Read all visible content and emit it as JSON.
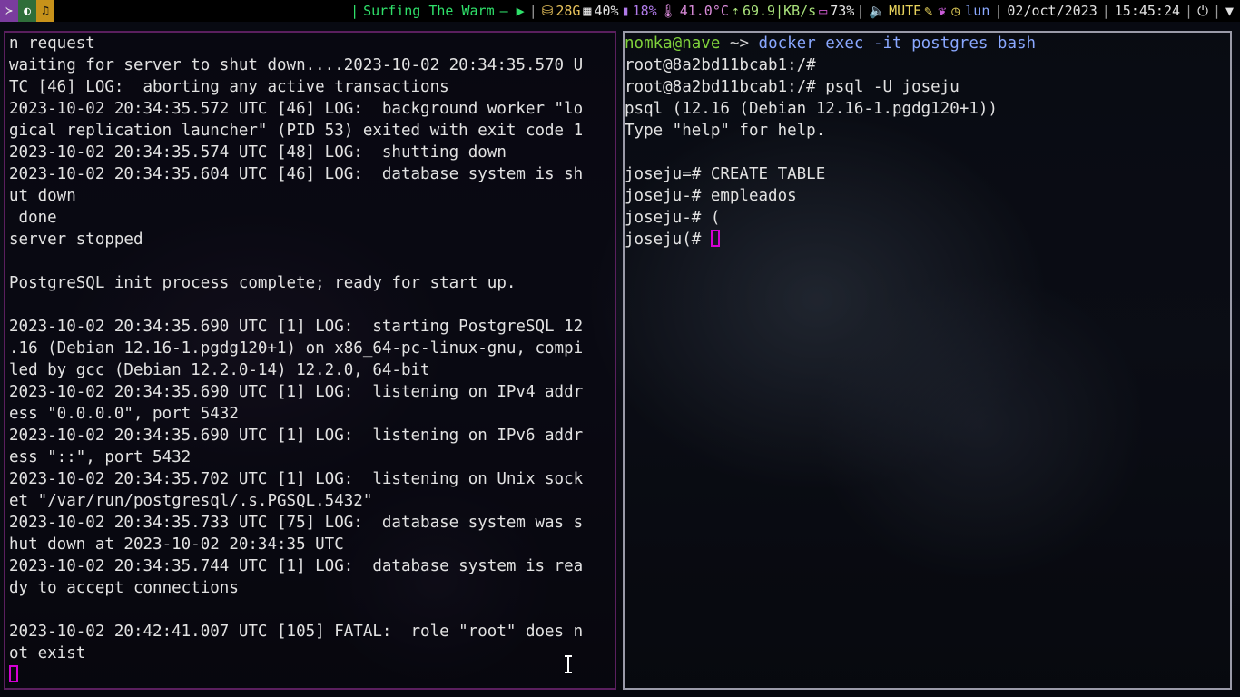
{
  "workspaces": [
    "≻",
    "◐",
    "♫"
  ],
  "bar": {
    "now_playing": "Surfing The Warm",
    "playback": "— ▶",
    "disk": "28G",
    "cpu": "40%",
    "mem": "18%",
    "temp": "41.0°C",
    "net": "69.9|KB/s",
    "battery": "73%",
    "volume": "MUTE",
    "day": "lun",
    "date": "02/oct/2023",
    "time": "15:45:24"
  },
  "left_terminal": {
    "lines": [
      "n request",
      "waiting for server to shut down....2023-10-02 20:34:35.570 U",
      "TC [46] LOG:  aborting any active transactions",
      "2023-10-02 20:34:35.572 UTC [46] LOG:  background worker \"lo",
      "gical replication launcher\" (PID 53) exited with exit code 1",
      "2023-10-02 20:34:35.574 UTC [48] LOG:  shutting down",
      "2023-10-02 20:34:35.604 UTC [46] LOG:  database system is sh",
      "ut down",
      " done",
      "server stopped",
      "",
      "PostgreSQL init process complete; ready for start up.",
      "",
      "2023-10-02 20:34:35.690 UTC [1] LOG:  starting PostgreSQL 12",
      ".16 (Debian 12.16-1.pgdg120+1) on x86_64-pc-linux-gnu, compi",
      "led by gcc (Debian 12.2.0-14) 12.2.0, 64-bit",
      "2023-10-02 20:34:35.690 UTC [1] LOG:  listening on IPv4 addr",
      "ess \"0.0.0.0\", port 5432",
      "2023-10-02 20:34:35.690 UTC [1] LOG:  listening on IPv6 addr",
      "ess \"::\", port 5432",
      "2023-10-02 20:34:35.702 UTC [1] LOG:  listening on Unix sock",
      "et \"/var/run/postgresql/.s.PGSQL.5432\"",
      "2023-10-02 20:34:35.733 UTC [75] LOG:  database system was s",
      "hut down at 2023-10-02 20:34:35 UTC",
      "2023-10-02 20:34:35.744 UTC [1] LOG:  database system is rea",
      "dy to accept connections",
      "",
      "2023-10-02 20:42:41.007 UTC [105] FATAL:  role \"root\" does n",
      "ot exist"
    ]
  },
  "right_terminal": {
    "prompt_user": "nomka@nave",
    "prompt_dir": "~>",
    "command": "docker exec -it postgres bash",
    "lines": [
      "root@8a2bd11bcab1:/#",
      "root@8a2bd11bcab1:/# psql -U joseju",
      "psql (12.16 (Debian 12.16-1.pgdg120+1))",
      "Type \"help\" for help.",
      "",
      "joseju=# CREATE TABLE",
      "joseju-# empleados",
      "joseju-# ("
    ],
    "last_prompt": "joseju(# "
  },
  "colors": {
    "accent_cursor": "#d400d4",
    "prompt_user": "#7fd13b",
    "command": "#8aa8ff"
  }
}
